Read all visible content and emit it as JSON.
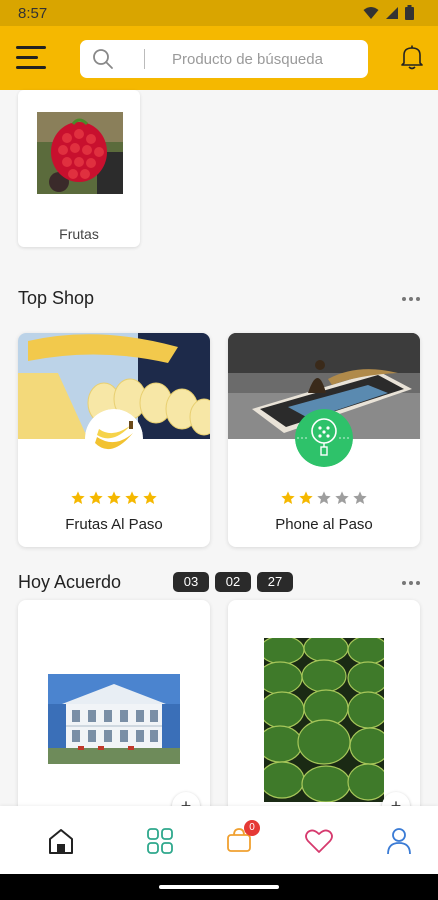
{
  "status_bar": {
    "time": "8:57"
  },
  "header": {
    "search_placeholder": "Producto de búsqueda",
    "accent_color": "#f5b800"
  },
  "categories": [
    {
      "label": "Frutas",
      "image": "raspberry-photo"
    }
  ],
  "top_shop": {
    "title": "Top Shop",
    "shops": [
      {
        "name": "Frutas Al Paso",
        "rating": 5,
        "max_rating": 5,
        "image": "banana-photo",
        "badge_icon": "banana-logo"
      },
      {
        "name": "Phone al Paso",
        "rating": 2,
        "max_rating": 5,
        "image": "phone-photo",
        "badge_icon": "phone-store-logo"
      }
    ]
  },
  "deals": {
    "title": "Hoy Acuerdo",
    "timer": {
      "hours": "03",
      "minutes": "02",
      "seconds": "27"
    },
    "items": [
      {
        "image": "house-photo"
      },
      {
        "image": "watermelon-photo"
      }
    ]
  },
  "bottom_nav": {
    "items": [
      "home-icon",
      "grid-icon",
      "cart-icon",
      "heart-icon",
      "user-icon"
    ],
    "cart_count": "0"
  },
  "colors": {
    "star_filled": "#f5b800",
    "star_empty": "#9e9e9e",
    "badge_green": "#2ec26a",
    "cart_badge": "#e53935"
  }
}
